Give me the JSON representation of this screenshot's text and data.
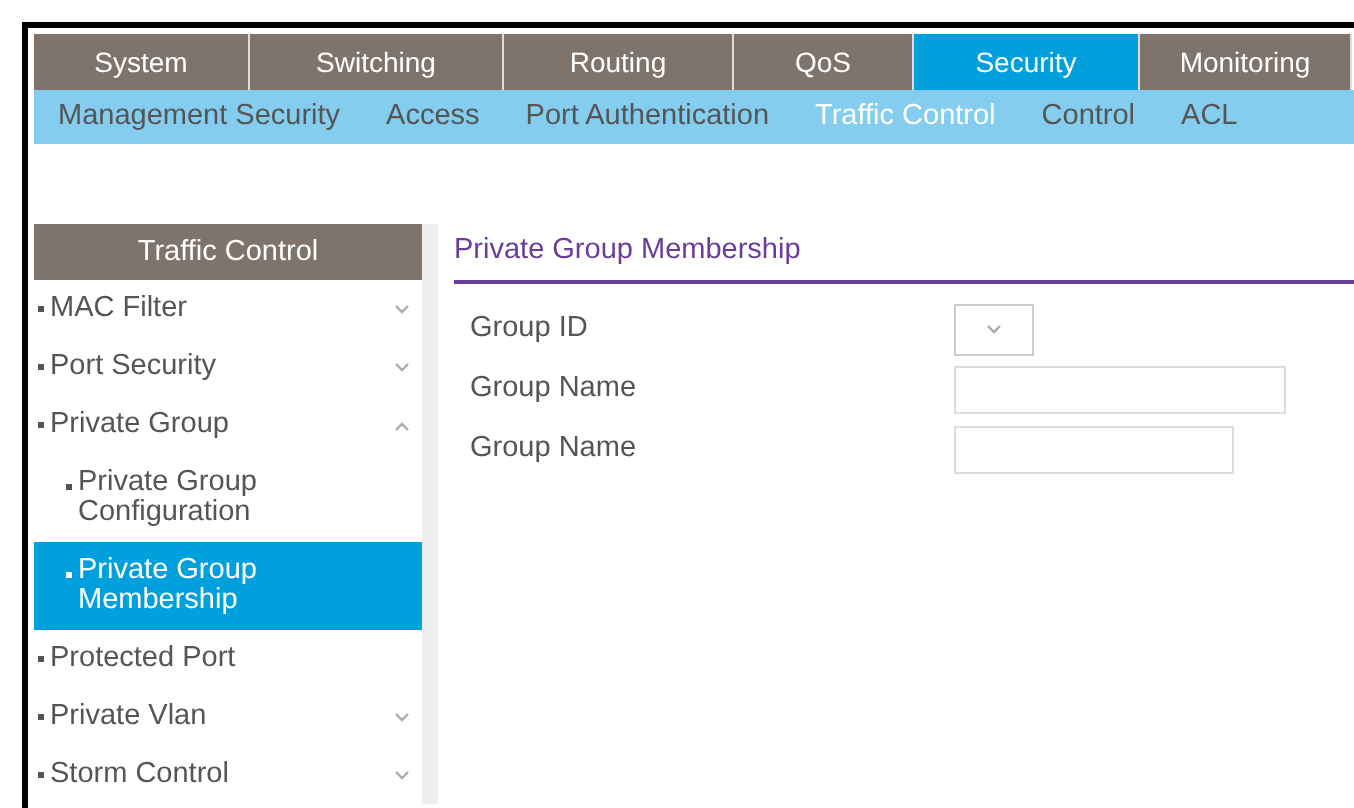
{
  "main_tabs": [
    {
      "label": "System",
      "selected": false
    },
    {
      "label": "Switching",
      "selected": false
    },
    {
      "label": "Routing",
      "selected": false
    },
    {
      "label": "QoS",
      "selected": false
    },
    {
      "label": "Security",
      "selected": true
    },
    {
      "label": "Monitoring",
      "selected": false
    }
  ],
  "sub_tabs": [
    {
      "label": "Management Security",
      "selected": false
    },
    {
      "label": "Access",
      "selected": false
    },
    {
      "label": "Port Authentication",
      "selected": false
    },
    {
      "label": "Traffic Control",
      "selected": true
    },
    {
      "label": "Control",
      "selected": false
    },
    {
      "label": "ACL",
      "selected": false
    }
  ],
  "sidebar": {
    "title": "Traffic Control",
    "items": [
      {
        "label": "MAC Filter",
        "kind": "group",
        "expanded": false,
        "selected": false
      },
      {
        "label": "Port Security",
        "kind": "group",
        "expanded": false,
        "selected": false
      },
      {
        "label": "Private Group",
        "kind": "group",
        "expanded": true,
        "selected": false,
        "children": [
          {
            "label": "Private Group Configuration",
            "selected": false
          },
          {
            "label": "Private Group Membership",
            "selected": true
          }
        ]
      },
      {
        "label": "Protected Port",
        "kind": "link",
        "selected": false
      },
      {
        "label": "Private Vlan",
        "kind": "group",
        "expanded": false,
        "selected": false
      },
      {
        "label": "Storm Control",
        "kind": "group",
        "expanded": false,
        "selected": false
      }
    ]
  },
  "panel": {
    "title": "Private Group Membership",
    "fields": [
      {
        "label": "Group ID",
        "kind": "select"
      },
      {
        "label": "Group Name",
        "kind": "text"
      },
      {
        "label": "Group Name",
        "kind": "text-short"
      }
    ]
  }
}
